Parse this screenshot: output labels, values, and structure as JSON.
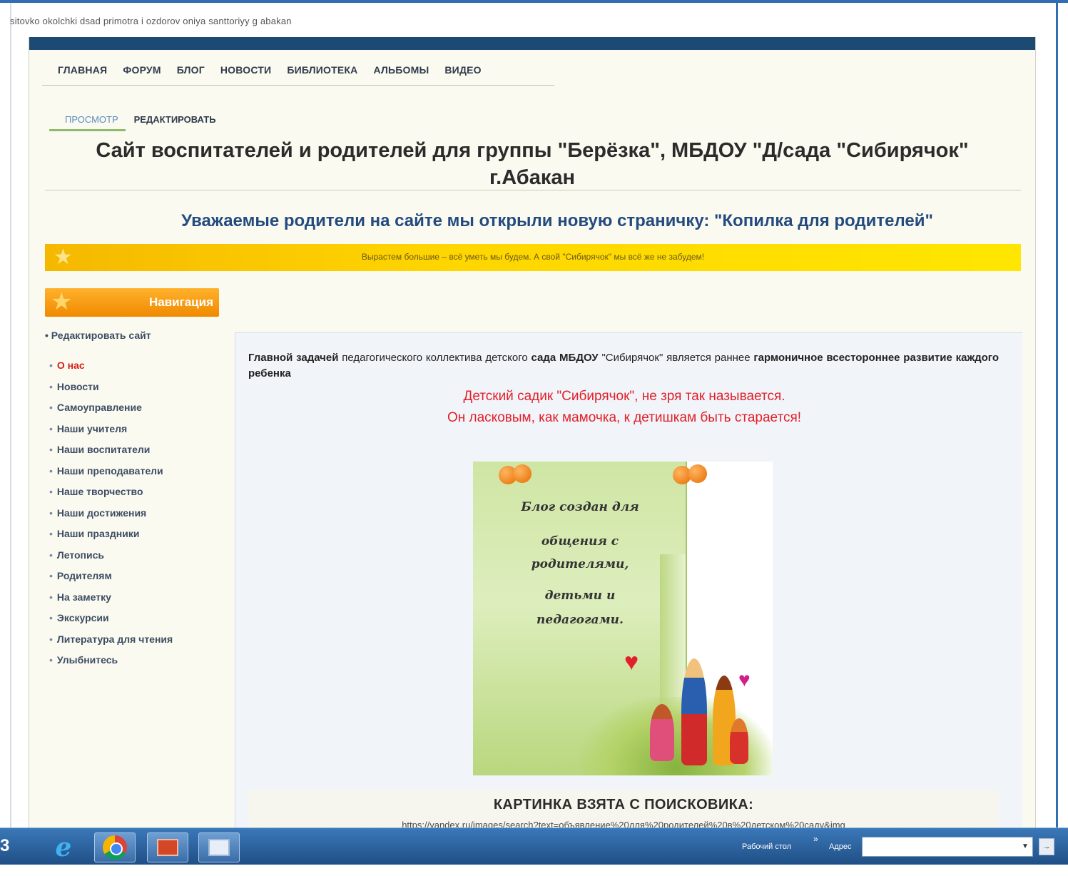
{
  "browser": {
    "url_strip": "sitovko okolchki dsad primotra i ozdorov oniya santtoriyy g abakan"
  },
  "nav": {
    "items": [
      "ГЛАВНАЯ",
      "ФОРУМ",
      "БЛОГ",
      "НОВОСТИ",
      "БИБЛИОТЕКА",
      "АЛЬБОМЫ",
      "ВИДЕО"
    ]
  },
  "tabs": {
    "view": "ПРОСМОТР",
    "edit": "РЕДАКТИРОВАТЬ"
  },
  "site_title": "Сайт воспитателей и родителей для группы \"Берёзка\", МБДОУ \"Д/сада \"Сибирячок\" г.Абакан",
  "notice": "Уважаемые родители на сайте мы открыли новую страничку: \"Копилка для родителей\"",
  "banner_text": "Вырастем большие – всё уметь мы будем. А свой \"Сибирячок\" мы всё же не забудем!",
  "sidebar": {
    "header": "Навигация",
    "edit_site": "Редактировать сайт",
    "items": [
      "О нас",
      "Новости",
      "Самоуправление",
      "Наши учителя",
      "Наши воспитатели",
      "Наши преподаватели",
      "Наше творчество",
      "Наши достижения",
      "Наши праздники",
      "Летопись",
      "Родителям",
      "На заметку",
      "Экскурсии",
      "Литература для чтения",
      "Улыбнитесь"
    ],
    "active_index": 0
  },
  "content": {
    "intro_bold_1": "Главной задачей",
    "intro_normal_1": " педагогического коллектива детского ",
    "intro_bold_2": "сада МБДОУ",
    "intro_normal_2": " \"Сибирячок\" является раннее ",
    "intro_bold_3": "гармоничное всестороннее развитие каждого ребенка",
    "poem_line1": "Детский садик \"Сибирячок\", не зря так называется.",
    "poem_line2": "Он ласковым, как мамочка, к детишкам быть старается!",
    "poster_lines": [
      "Блог создан для",
      "общения с",
      "родителями,",
      "детьми и",
      "педагогами."
    ],
    "caption_title": "КАРТИНКА ВЗЯТА С ПОИСКОВИКА:",
    "caption_url": "https://yandex.ru/images/search?text=объявление%20для%20родителей%20в%20детском%20саду&img"
  },
  "taskbar": {
    "start_label": "3",
    "desktop_label": "Рабочий стол",
    "arrows": "»",
    "address_label": "Адрес",
    "address_value": "",
    "go_label": "→"
  },
  "colors": {
    "nav_bar": "#1d4a73",
    "banner": "#ffd500",
    "nav_header": "#f08a00",
    "poem_red": "#e2202a",
    "notice_blue": "#244b80"
  }
}
